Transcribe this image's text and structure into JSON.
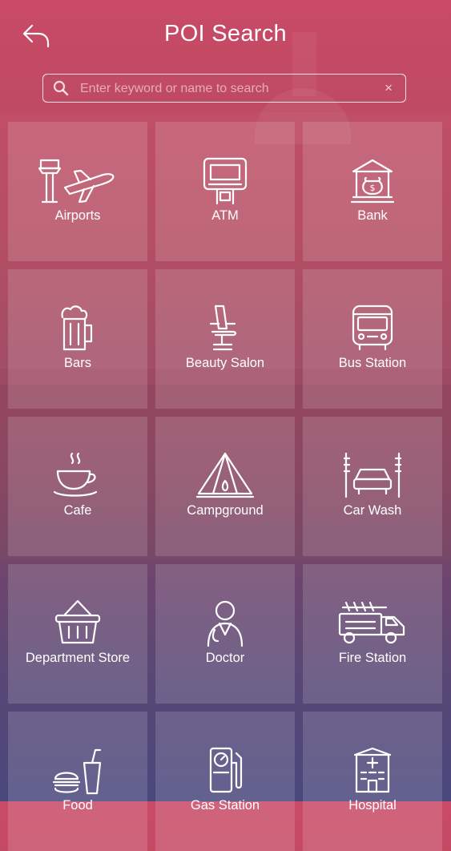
{
  "header": {
    "title": "POI Search",
    "back_icon": "back-arrow-icon"
  },
  "search": {
    "placeholder": "Enter keyword or name to search",
    "value": "",
    "clear_symbol": "×"
  },
  "categories": [
    {
      "label": "Airports",
      "icon": "airport-icon"
    },
    {
      "label": "ATM",
      "icon": "atm-icon"
    },
    {
      "label": "Bank",
      "icon": "bank-icon"
    },
    {
      "label": "Bars",
      "icon": "beer-mug-icon"
    },
    {
      "label": "Beauty Salon",
      "icon": "salon-chair-icon"
    },
    {
      "label": "Bus Station",
      "icon": "bus-icon"
    },
    {
      "label": "Cafe",
      "icon": "coffee-cup-icon"
    },
    {
      "label": "Campground",
      "icon": "tent-icon"
    },
    {
      "label": "Car Wash",
      "icon": "car-wash-icon"
    },
    {
      "label": "Department Store",
      "icon": "shopping-basket-icon"
    },
    {
      "label": "Doctor",
      "icon": "doctor-icon"
    },
    {
      "label": "Fire Station",
      "icon": "fire-truck-icon"
    },
    {
      "label": "Food",
      "icon": "fast-food-icon"
    },
    {
      "label": "Gas Station",
      "icon": "gas-pump-icon"
    },
    {
      "label": "Hospital",
      "icon": "hospital-icon"
    }
  ]
}
